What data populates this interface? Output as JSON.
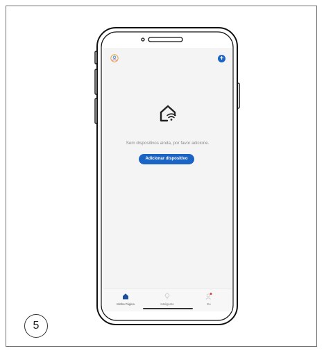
{
  "step_number": "5",
  "screen": {
    "empty_message": "Sem dispositivos ainda, por favor adicione.",
    "add_device_label": "Adicionar dispositivo"
  },
  "tabs": [
    {
      "label": "Minha Página",
      "icon": "home-icon",
      "active": true
    },
    {
      "label": "Inteligente",
      "icon": "lightbulb-icon",
      "active": false
    },
    {
      "label": "Eu",
      "icon": "user-icon",
      "active": false
    }
  ],
  "colors": {
    "accent": "#1c64c4",
    "notification": "#e5323b"
  }
}
